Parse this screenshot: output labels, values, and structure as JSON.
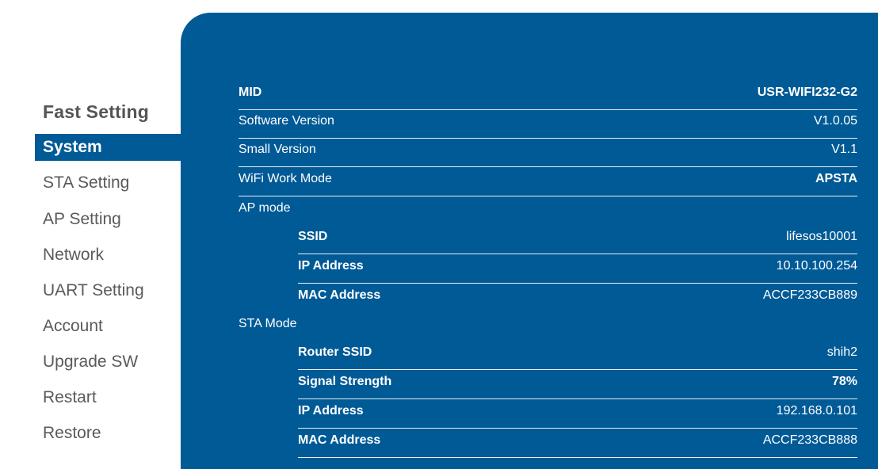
{
  "sidebar": {
    "title": "Fast Setting",
    "items": [
      {
        "label": "System",
        "active": true
      },
      {
        "label": "STA Setting",
        "active": false
      },
      {
        "label": "AP Setting",
        "active": false
      },
      {
        "label": "Network",
        "active": false
      },
      {
        "label": "UART Setting",
        "active": false
      },
      {
        "label": "Account",
        "active": false
      },
      {
        "label": "Upgrade SW",
        "active": false
      },
      {
        "label": "Restart",
        "active": false
      },
      {
        "label": "Restore",
        "active": false
      }
    ]
  },
  "info": {
    "mid": {
      "label": "MID",
      "value": "USR-WIFI232-G2"
    },
    "software_version": {
      "label": "Software Version",
      "value": "V1.0.05"
    },
    "small_version": {
      "label": "Small Version",
      "value": "V1.1"
    },
    "wifi_work_mode": {
      "label": "WiFi Work Mode",
      "value": "APSTA"
    },
    "ap_mode": {
      "heading": "AP mode",
      "ssid": {
        "label": "SSID",
        "value": "lifesos10001"
      },
      "ip_address": {
        "label": "IP Address",
        "value": "10.10.100.254"
      },
      "mac_address": {
        "label": "MAC Address",
        "value": "ACCF233CB889"
      }
    },
    "sta_mode": {
      "heading": "STA Mode",
      "router_ssid": {
        "label": "Router SSID",
        "value": "shih2"
      },
      "signal_strength": {
        "label": "Signal Strength",
        "value": "78%"
      },
      "ip_address": {
        "label": "IP Address",
        "value": "192.168.0.101"
      },
      "mac_address": {
        "label": "MAC Address",
        "value": "ACCF233CB888"
      }
    }
  },
  "colors": {
    "panel": "#005a96",
    "active_item": "#005a96",
    "sidebar_text": "#5a5a5a"
  }
}
